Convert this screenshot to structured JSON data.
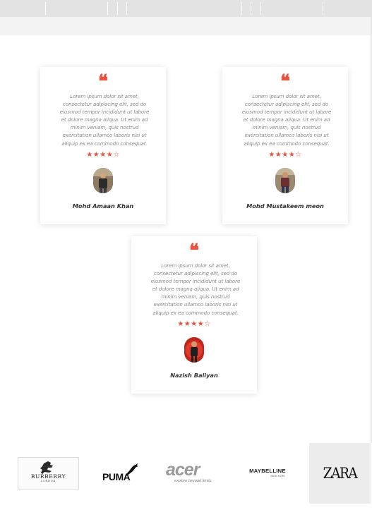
{
  "header": {},
  "testimonials": [
    {
      "quote_icon": "quote-icon",
      "text": "Lorem ipsum dolor sit amet, consectetur adipiscing elit, sed do eiusmod tempor incididunt ut labore et dolore magna aliqua. Ut enim ad minim veniam, quis nostrud exercitation ullamco laboris nisi ut aliquip ex ea commodo consequat.",
      "rating": 4,
      "rating_max": 5,
      "stars": "★★★★☆",
      "name": "Mohd Amaan Khan"
    },
    {
      "quote_icon": "quote-icon",
      "text": "Lorem ipsum dolor sit amet, consectetur adipiscing elit, sed do eiusmod tempor incididunt ut labore et dolore magna aliqua. Ut enim ad minim veniam, quis nostrud exercitation ullamco laboris nisi ut aliquip ex ea commodo consequat.",
      "rating": 4,
      "rating_max": 5,
      "stars": "★★★★☆",
      "name": "Mohd Mustakeem meon"
    },
    {
      "quote_icon": "quote-icon",
      "text": "Lorem ipsum dolor sit amet, consectetur adipiscing elit, sed do eiusmod tempor incididunt ut labore et dolore magna aliqua. Ut enim ad minim veniam, quis nostrud exercitation ullamco laboris nisi ut aliquip ex ea commodo consequat.",
      "rating": 4,
      "rating_max": 5,
      "stars": "★★★★☆",
      "name": "Nazish Baliyan"
    }
  ],
  "brands": {
    "burberry": "BURBERRY",
    "burberry_sub": "LONDON",
    "puma": "PUMA",
    "acer": "acer",
    "acer_tagline": "explore beyond limits",
    "maybelline": "MAYBELLINE",
    "maybelline_sub": "NEW YORK",
    "zara": "ZARA"
  },
  "colors": {
    "accent": "#e8533f",
    "body_text": "#8a8a8a",
    "name_text": "#333333",
    "topbar": "#e3e3e3"
  }
}
